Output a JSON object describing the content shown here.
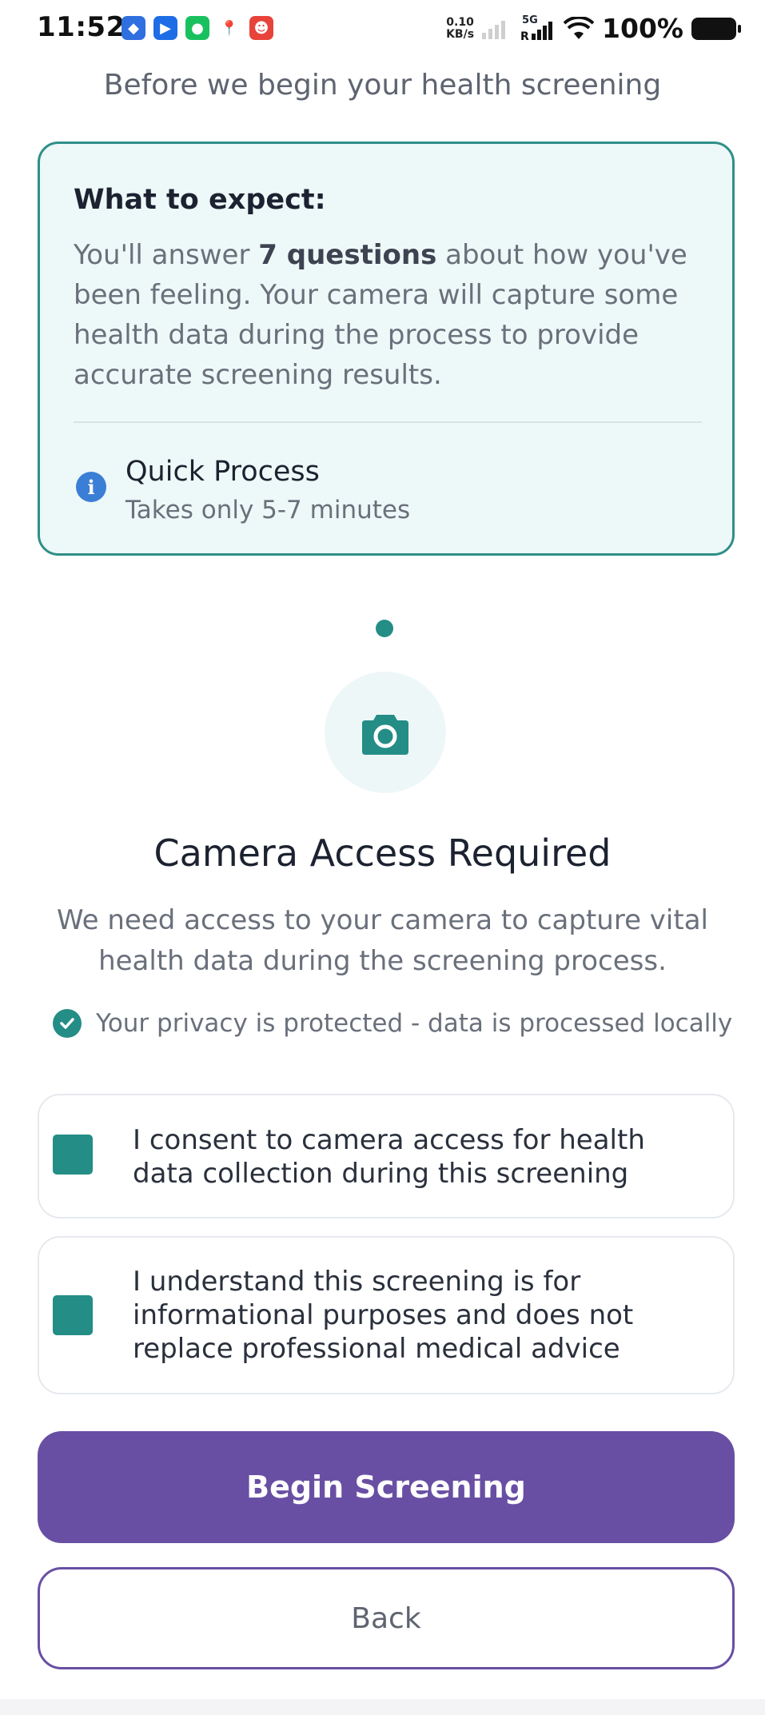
{
  "status_bar": {
    "time": "11:52",
    "network_speed_value": "0.10",
    "network_speed_unit": "KB/s",
    "network_type": "5G",
    "battery": "100%"
  },
  "page": {
    "title": "Before we begin your health screening"
  },
  "expect_card": {
    "title": "What to expect:",
    "text_before": "You'll answer ",
    "text_bold": "7 questions",
    "text_after": " about how you've been feeling. Your camera will capture some health data during the process to provide accurate screening results.",
    "quick_process_title": "Quick Process",
    "quick_process_subtitle": "Takes only 5-7 minutes"
  },
  "camera": {
    "title": "Camera Access Required",
    "description": "We need access to your camera to capture vital health data during the screening process.",
    "privacy_note": "Your privacy is protected - data is processed locally"
  },
  "consents": [
    {
      "label": "I consent to camera access for health data collection during this screening",
      "checked": true
    },
    {
      "label": "I understand this screening is for informational purposes and does not replace professional medical advice",
      "checked": true
    }
  ],
  "buttons": {
    "primary": "Begin Screening",
    "secondary": "Back"
  },
  "colors": {
    "teal": "#238d86",
    "purple": "#684fa3",
    "card_bg": "#edf8f8"
  }
}
